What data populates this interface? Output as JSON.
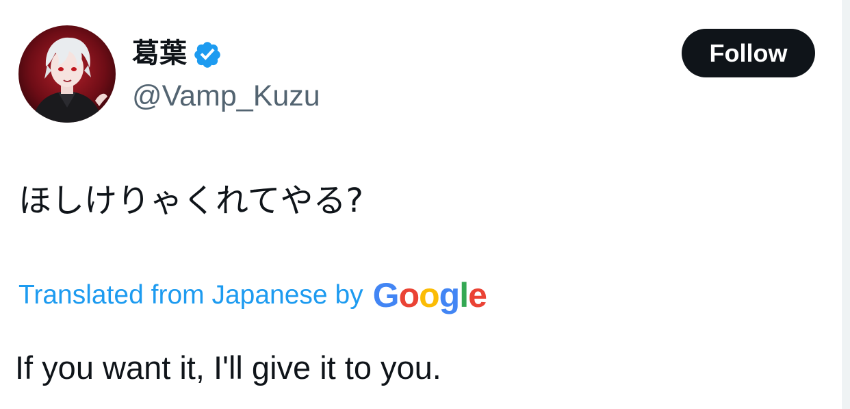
{
  "author": {
    "display_name": "葛葉",
    "handle": "@Vamp_Kuzu",
    "verified_badge": "verified-badge-icon",
    "avatar": "avatar"
  },
  "actions": {
    "follow_label": "Follow"
  },
  "tweet": {
    "text": "ほしけりゃくれてやる?"
  },
  "translation": {
    "label": "Translated from Japanese by",
    "provider_logo": "Google",
    "text": "If you want it, I'll give it to you."
  },
  "colors": {
    "link": "#1d9bf0",
    "verified": "#1d9bf0",
    "handle": "#536471",
    "text": "#0f1419",
    "follow_bg": "#0f1419",
    "google_blue": "#4285F4",
    "google_red": "#EA4335",
    "google_yellow": "#FBBC05",
    "google_green": "#34A853"
  }
}
